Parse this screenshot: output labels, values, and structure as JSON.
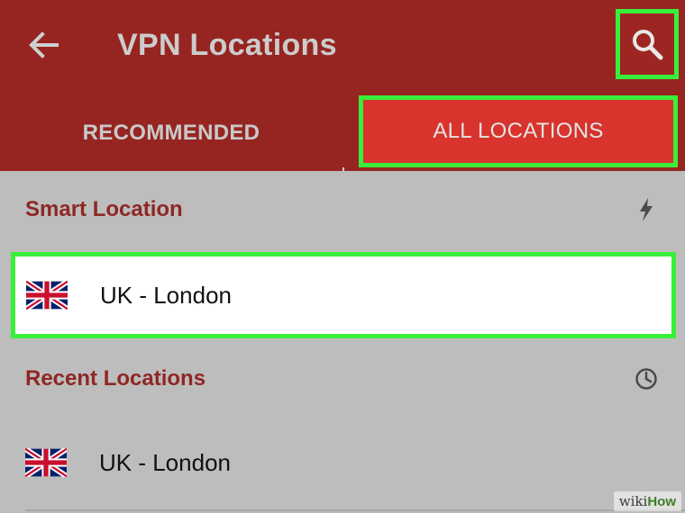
{
  "app_bar": {
    "back_icon": "arrow-left-icon",
    "title": "VPN Locations",
    "search_icon": "search-icon"
  },
  "tabs": [
    {
      "label": "RECOMMENDED",
      "selected": false
    },
    {
      "label": "ALL LOCATIONS",
      "selected": true
    }
  ],
  "smart_location": {
    "title": "Smart Location",
    "icon": "lightning-bolt-icon",
    "item": {
      "flag": "uk-flag-icon",
      "label": "UK - London"
    }
  },
  "recent_locations": {
    "title": "Recent Locations",
    "icon": "clock-icon",
    "items": [
      {
        "flag": "uk-flag-icon",
        "label": "UK - London"
      }
    ]
  },
  "watermark": {
    "prefix": "wiki",
    "suffix": "How"
  },
  "colors": {
    "app_bar": "#962521",
    "selected_tab": "#d8332c",
    "highlight_outline": "#39ef39",
    "section_title": "#8f2724",
    "background": "#bdbdbd"
  }
}
